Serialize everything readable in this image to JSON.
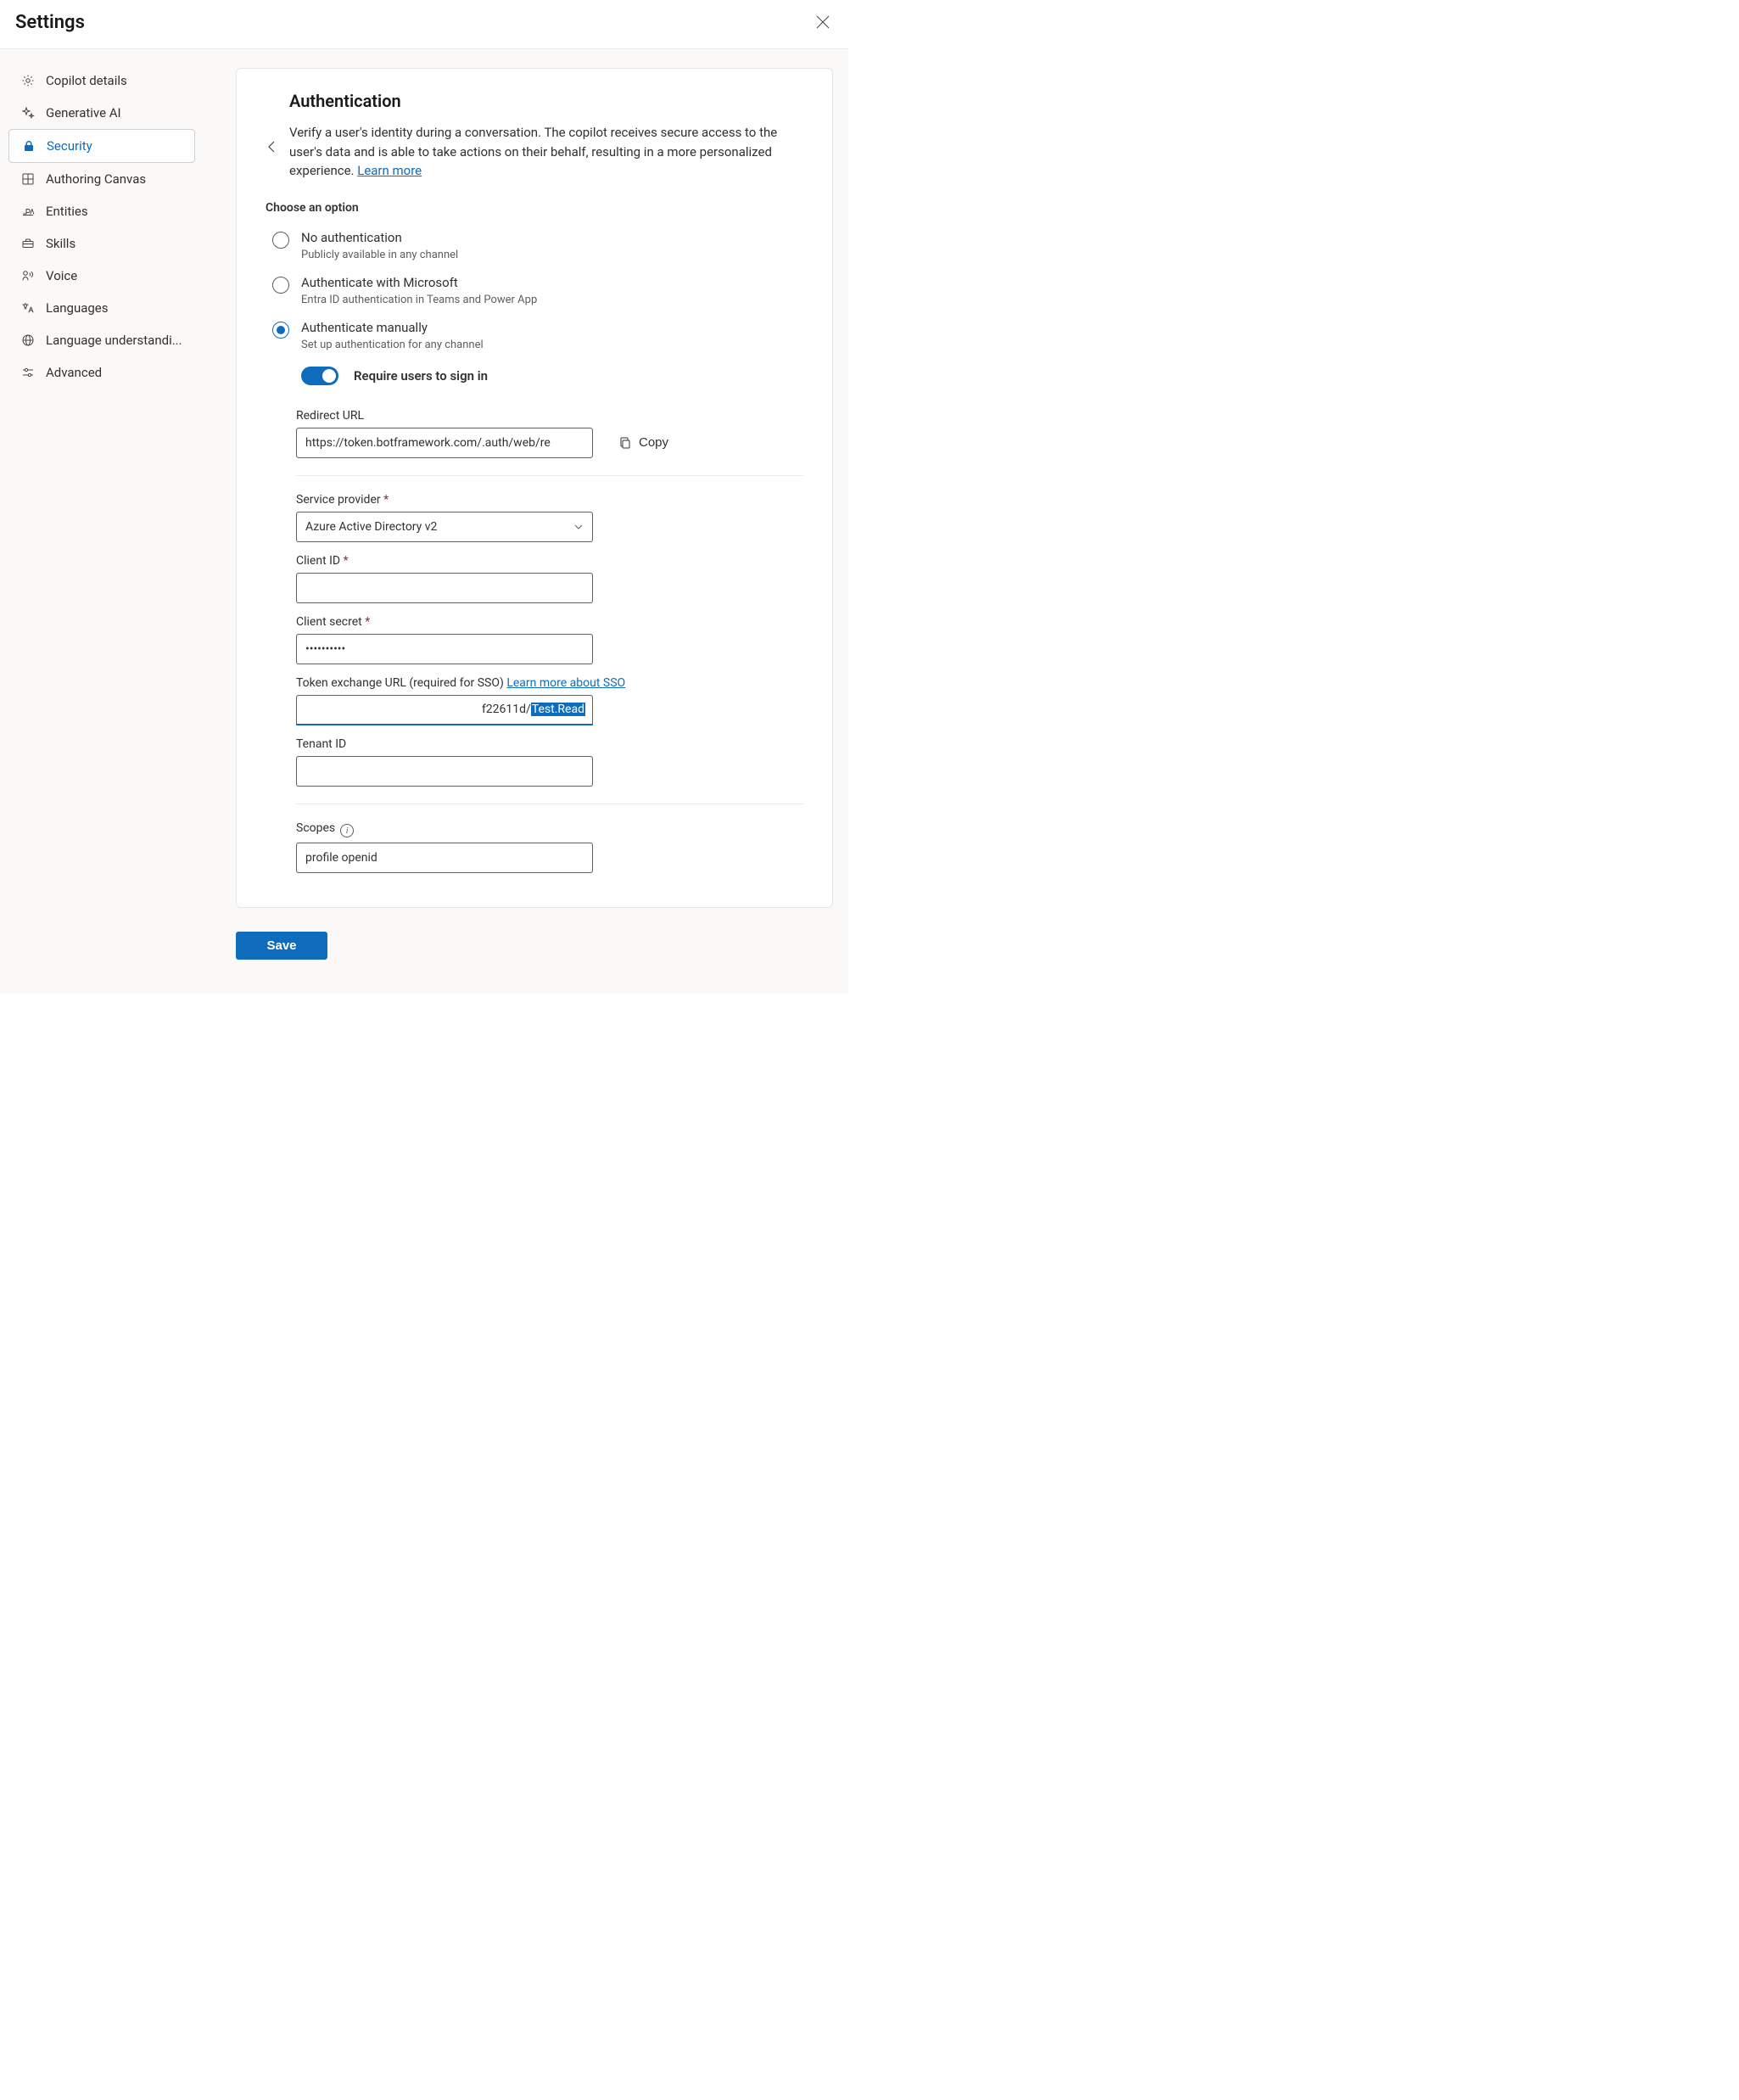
{
  "header": {
    "title": "Settings"
  },
  "sidebar": {
    "items": [
      {
        "label": "Copilot details"
      },
      {
        "label": "Generative AI"
      },
      {
        "label": "Security"
      },
      {
        "label": "Authoring Canvas"
      },
      {
        "label": "Entities"
      },
      {
        "label": "Skills"
      },
      {
        "label": "Voice"
      },
      {
        "label": "Languages"
      },
      {
        "label": "Language understandi..."
      },
      {
        "label": "Advanced"
      }
    ],
    "selected_index": 2
  },
  "panel": {
    "title": "Authentication",
    "description": "Verify a user's identity during a conversation. The copilot receives secure access to the user's data and is able to take actions on their behalf, resulting in a more personalized experience. ",
    "learn_more": "Learn more",
    "choose_heading": "Choose an option",
    "options": [
      {
        "label": "No authentication",
        "sub": "Publicly available in any channel"
      },
      {
        "label": "Authenticate with Microsoft",
        "sub": "Entra ID authentication in Teams and Power App"
      },
      {
        "label": "Authenticate manually",
        "sub": "Set up authentication for any channel"
      }
    ],
    "selected_option_index": 2,
    "require_sign_in": {
      "label": "Require users to sign in",
      "on": true
    },
    "redirect": {
      "label": "Redirect URL",
      "value": "https://token.botframework.com/.auth/web/re",
      "copy": "Copy"
    },
    "service_provider": {
      "label": "Service provider",
      "value": "Azure Active Directory v2"
    },
    "client_id": {
      "label": "Client ID",
      "value": ""
    },
    "client_secret": {
      "label": "Client secret",
      "value": "••••••••••"
    },
    "token_exchange": {
      "label": "Token exchange URL (required for SSO) ",
      "link": "Learn more about SSO",
      "prefix": "f22611d/",
      "selected": "Test.Read"
    },
    "tenant_id": {
      "label": "Tenant ID",
      "value": ""
    },
    "scopes": {
      "label": "Scopes",
      "value": "profile openid"
    }
  },
  "footer": {
    "save": "Save"
  }
}
